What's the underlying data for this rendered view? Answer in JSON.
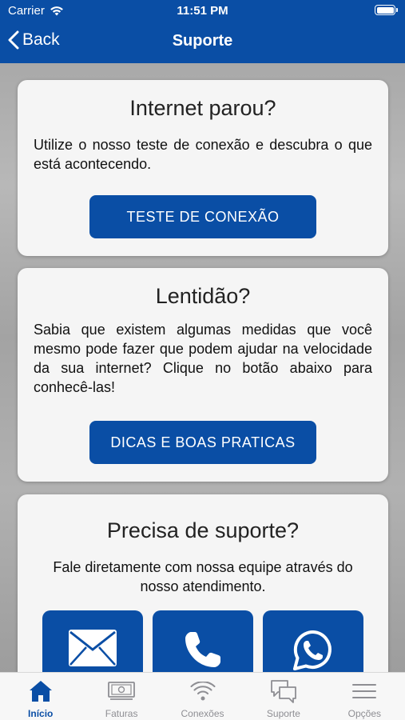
{
  "status": {
    "carrier": "Carrier",
    "time": "11:51 PM"
  },
  "nav": {
    "back_label": "Back",
    "title": "Suporte"
  },
  "cards": [
    {
      "title": "Internet parou?",
      "text": "Utilize o nosso teste de conexão e descubra o que está acontecendo.",
      "button": "TESTE DE CONEXÃO"
    },
    {
      "title": "Lentidão?",
      "text": "Sabia que existem algumas medidas que você mesmo pode fazer que podem ajudar na velocidade da sua internet? Clique no botão abaixo para conhecê-las!",
      "button": "DICAS E BOAS PRATICAS"
    },
    {
      "title": "Precisa de suporte?",
      "text": "Fale diretamente com nossa equipe através do nosso atendimento.",
      "contacts": [
        "email-icon",
        "phone-icon",
        "whatsapp-icon"
      ]
    }
  ],
  "tabs": [
    {
      "label": "Início",
      "icon": "home-icon",
      "active": true
    },
    {
      "label": "Faturas",
      "icon": "bill-icon",
      "active": false
    },
    {
      "label": "Conexões",
      "icon": "wifi-icon",
      "active": false
    },
    {
      "label": "Suporte",
      "icon": "chat-icon",
      "active": false
    },
    {
      "label": "Opções",
      "icon": "menu-icon",
      "active": false
    }
  ],
  "colors": {
    "primary": "#0a4ea5",
    "tab_inactive": "#8e8e93",
    "card_bg": "#f5f5f5"
  }
}
